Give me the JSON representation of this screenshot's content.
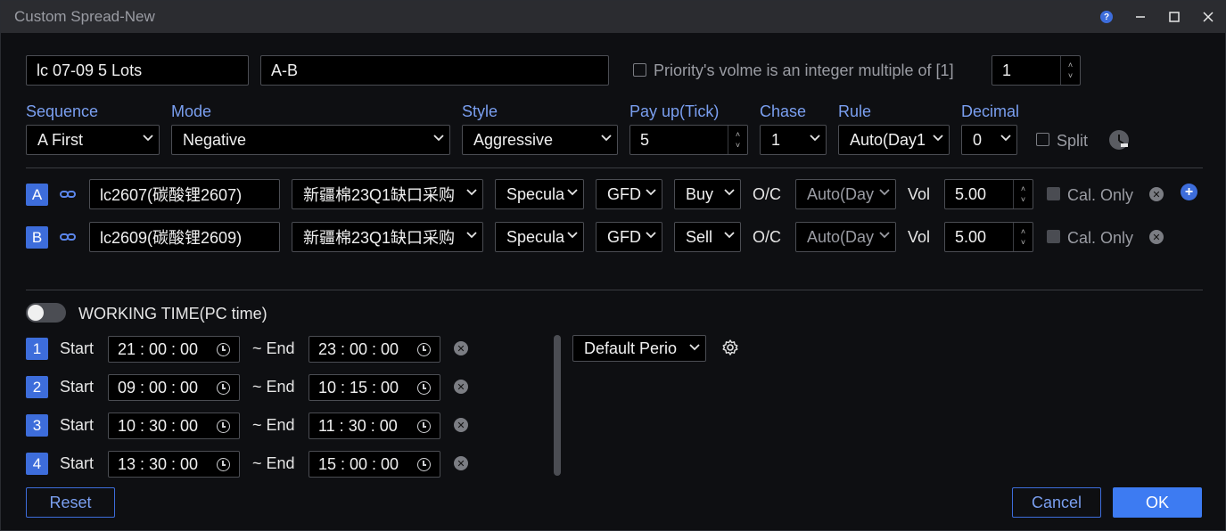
{
  "window": {
    "title": "Custom Spread-New",
    "help_icon": "help-icon",
    "controls": [
      "minimize-icon",
      "maximize-icon",
      "close-icon"
    ]
  },
  "header": {
    "name_value": "lc 07-09 5 Lots",
    "formula_value": "A-B",
    "priority_label": "Priority's volme is an integer multiple of [1]",
    "priority_value": "1",
    "priority_checked": false
  },
  "settings": {
    "sequence": {
      "label": "Sequence",
      "value": "A First"
    },
    "mode": {
      "label": "Mode",
      "value": "Negative"
    },
    "style": {
      "label": "Style",
      "value": "Aggressive"
    },
    "payup": {
      "label": "Pay up(Tick)",
      "value": "5"
    },
    "chase": {
      "label": "Chase",
      "value": "1"
    },
    "rule": {
      "label": "Rule",
      "value": "Auto(Day1"
    },
    "decimal": {
      "label": "Decimal",
      "value": "0"
    },
    "split": {
      "label": "Split",
      "checked": false
    }
  },
  "legs": [
    {
      "tag": "A",
      "contract": "lc2607(碳酸锂2607)",
      "account": "新疆棉23Q1缺口采购",
      "hedge": "Specula",
      "tif": "GFD",
      "side": "Buy",
      "oc_label": "O/C",
      "oc_value": "Auto(Day",
      "vol_label": "Vol",
      "vol_value": "5.00",
      "cal_only": "Cal. Only"
    },
    {
      "tag": "B",
      "contract": "lc2609(碳酸锂2609)",
      "account": "新疆棉23Q1缺口采购",
      "hedge": "Specula",
      "tif": "GFD",
      "side": "Sell",
      "oc_label": "O/C",
      "oc_value": "Auto(Day",
      "vol_label": "Vol",
      "vol_value": "5.00",
      "cal_only": "Cal. Only"
    }
  ],
  "working_time": {
    "label": "WORKING TIME(PC time)",
    "enabled": false,
    "start_label": "Start",
    "end_label": "~ End",
    "periods": [
      {
        "index": "1",
        "start": "21 : 00 : 00",
        "end": "23 : 00 : 00"
      },
      {
        "index": "2",
        "start": "09 : 00 : 00",
        "end": "10 : 15 : 00"
      },
      {
        "index": "3",
        "start": "10 : 30 : 00",
        "end": "11 : 30 : 00"
      },
      {
        "index": "4",
        "start": "13 : 30 : 00",
        "end": "15 : 00 : 00"
      }
    ],
    "period_preset": "Default Perio"
  },
  "footer": {
    "reset": "Reset",
    "cancel": "Cancel",
    "ok": "OK"
  },
  "colors": {
    "accent": "#3d6ddb",
    "label_blue": "#7a9ff0",
    "background": "#0e0f12",
    "titlebar": "#2b2c30"
  }
}
